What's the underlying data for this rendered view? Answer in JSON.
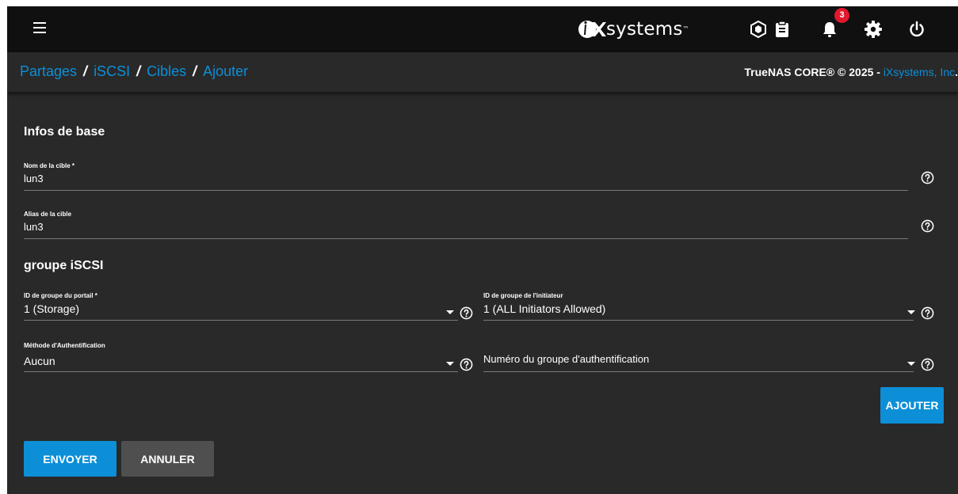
{
  "topbar": {
    "logo_text": "systems",
    "logo_tm": "™",
    "notification_count": "3"
  },
  "breadcrumb": {
    "items": [
      "Partages",
      "iSCSI",
      "Cibles",
      "Ajouter"
    ],
    "separator": "/"
  },
  "copyright": {
    "text": "TrueNAS CORE® © 2025 - ",
    "link": "iXsystems, Inc",
    "suffix": "."
  },
  "form": {
    "basic_section": "Infos de base",
    "target_name": {
      "label": "Nom de la cible *",
      "value": "lun3"
    },
    "target_alias": {
      "label": "Alias de la cible",
      "value": "lun3"
    },
    "group_section": "groupe iSCSI",
    "portal_group": {
      "label": "ID de groupe du portail *",
      "value": "1 (Storage)"
    },
    "initiator_group": {
      "label": "ID de groupe de l'initiateur",
      "value": "1 (ALL Initiators Allowed)"
    },
    "auth_method": {
      "label": "Méthode d'Authentification",
      "value": "Aucun"
    },
    "auth_group": {
      "label": "",
      "value": "",
      "placeholder": "Numéro du groupe d'authentification"
    },
    "add_label": "AJOUTER",
    "submit_label": "ENVOYER",
    "cancel_label": "ANNULER"
  },
  "colors": {
    "accent": "#0d8fd7",
    "background": "#292929",
    "topbar": "#101010",
    "badge": "#e1182d",
    "secondary_button": "#4f4f4f"
  },
  "icons": [
    "menu-icon",
    "ix-logo-icon",
    "truecommand-icon",
    "clipboard-icon",
    "bell-icon",
    "gear-icon",
    "power-icon",
    "help-icon",
    "chevron-down-icon"
  ]
}
